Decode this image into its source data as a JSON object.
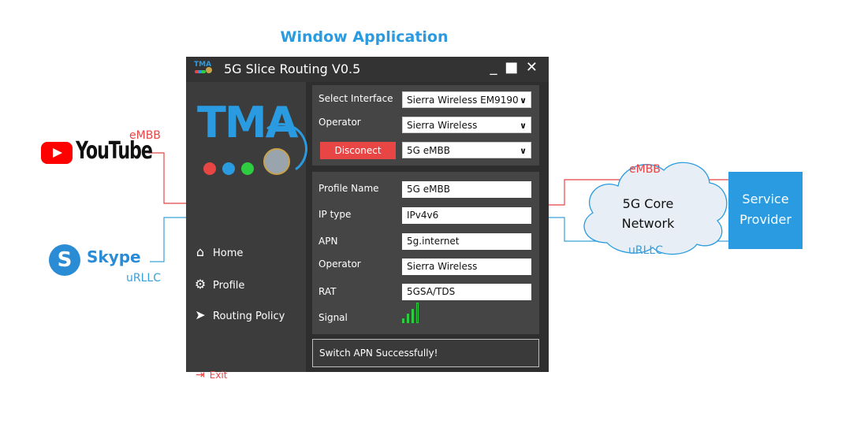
{
  "diagram": {
    "title": "Window Application"
  },
  "left": {
    "youtube": {
      "logo_text": "YouTube",
      "tag": "eMBB"
    },
    "skype": {
      "logo_text": "Skype",
      "tag": "uRLLC",
      "icon_letter": "S"
    }
  },
  "window": {
    "logo_small": "TMA",
    "title": "5G Slice Routing V0.5",
    "controls": "_ ■ ✕",
    "sidebar": {
      "logo": "TMA",
      "items": [
        {
          "label": "Home",
          "icon": "home-icon"
        },
        {
          "label": "Profile",
          "icon": "gear-icon"
        },
        {
          "label": "Routing Policy",
          "icon": "paper-plane-icon"
        }
      ],
      "exit_label": "Exit"
    },
    "top_panel": {
      "interface_label": "Select Interface",
      "interface_value": "Sierra Wireless EM9190",
      "operator_label": "Operator",
      "operator_value": "Sierra Wireless",
      "disconnect_label": "Disconect",
      "slice_value": "5G eMBB"
    },
    "profile": {
      "fields": [
        {
          "label": "Profile Name",
          "value": "5G eMBB"
        },
        {
          "label": "IP type",
          "value": "IPv4v6"
        },
        {
          "label": "APN",
          "value": "5g.internet"
        },
        {
          "label": "Operator",
          "value": "Sierra Wireless"
        },
        {
          "label": "RAT",
          "value": "5GSA/TDS"
        }
      ],
      "signal_label": "Signal",
      "signal_bars": 4,
      "signal_level": 3
    },
    "status": "Switch APN Successfully!"
  },
  "right": {
    "cloud": {
      "embb": "eMBB",
      "urllc": "uRLLC",
      "line1": "5G Core",
      "line2": "Network"
    },
    "provider": {
      "line1": "Service",
      "line2": "Provider"
    }
  },
  "colors": {
    "accent_blue": "#2a9be0",
    "embb_red": "#e84545",
    "urllc_blue": "#3aa0d8",
    "signal_green": "#2ecc40",
    "window_dark": "#2e2e2e"
  }
}
